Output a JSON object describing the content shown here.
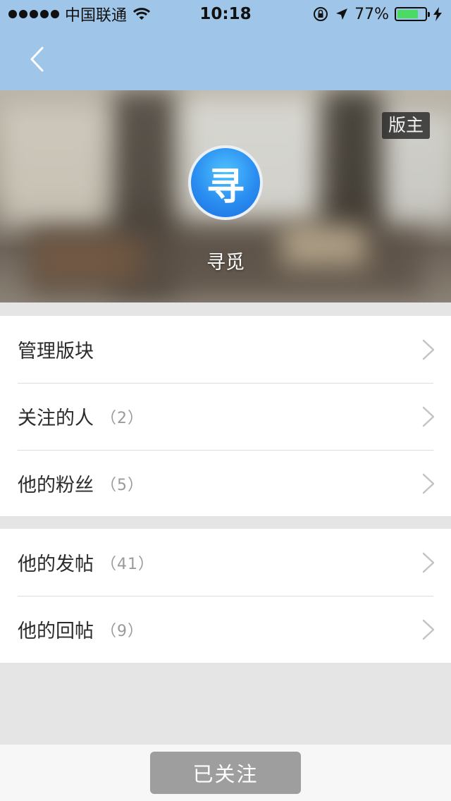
{
  "status_bar": {
    "carrier": "中国联通",
    "time": "10:18",
    "battery_percent": "77%",
    "battery_level": 0.77,
    "icons": [
      "signal-dots-icon",
      "wifi-icon",
      "orientation-lock-icon",
      "location-arrow-icon",
      "battery-icon",
      "charging-bolt-icon"
    ]
  },
  "nav": {
    "back_icon": "chevron-left-icon"
  },
  "profile": {
    "role_badge": "版主",
    "avatar_glyph": "寻",
    "username": "寻觅"
  },
  "groups": [
    {
      "rows": [
        {
          "label": "管理版块",
          "count": ""
        },
        {
          "label": "关注的人",
          "count": "（2）"
        },
        {
          "label": "他的粉丝",
          "count": "（5）"
        }
      ]
    },
    {
      "rows": [
        {
          "label": "他的发帖",
          "count": "（41）"
        },
        {
          "label": "他的回帖",
          "count": "（9）"
        }
      ]
    }
  ],
  "footer": {
    "follow_button": "已关注"
  },
  "colors": {
    "nav_background": "#9fc6e8",
    "page_background": "#e5e5e5",
    "follow_button": "#9e9e9e",
    "avatar_blue": "#2a8df0"
  }
}
